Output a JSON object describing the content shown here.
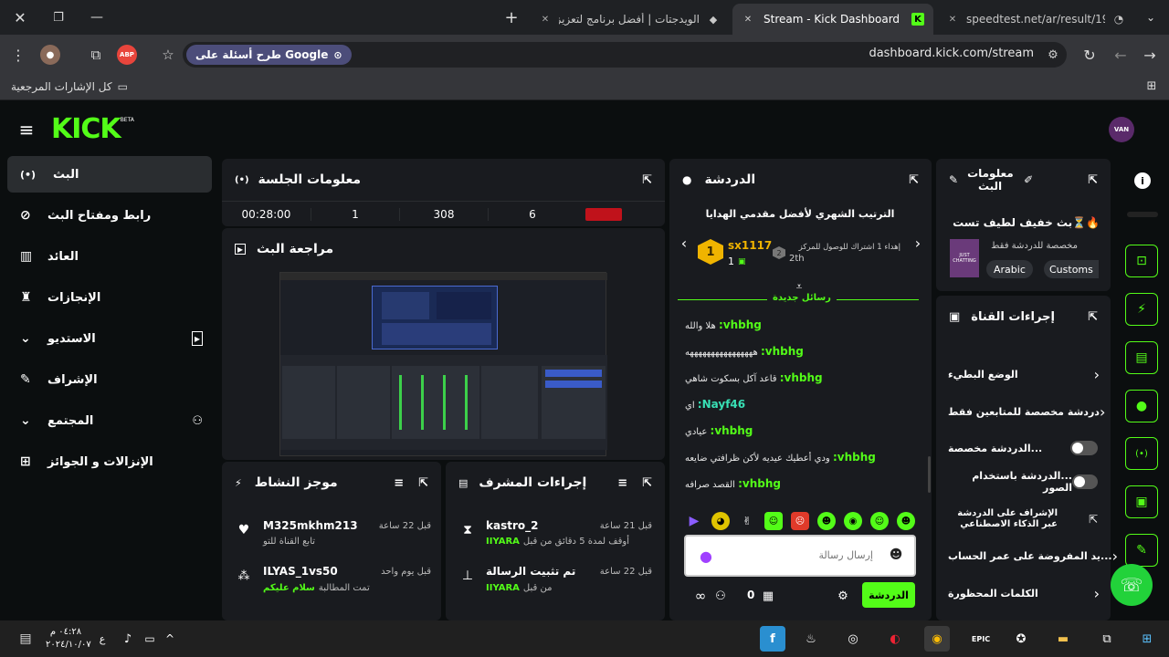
{
  "browser": {
    "tabs": [
      {
        "label": "speedtest.net/ar/result/190016"
      },
      {
        "label": "Stream - Kick Dashboard"
      },
      {
        "label": "الويدجتات | أفضل برنامج لتعزيز ال"
      }
    ],
    "url": "dashboard.kick.com/stream",
    "google_chip": "طرح أسئلة على Google",
    "abp_badge": "ABP",
    "bookmarks_label": "كل الإشارات المرجعية"
  },
  "kick": {
    "logo": "KICK",
    "logo_badge": "BETA",
    "avatar_text": "VAN"
  },
  "sidebar": {
    "items": [
      {
        "label": "البث"
      },
      {
        "label": "رابط ومفتاح البث"
      },
      {
        "label": "العائد"
      },
      {
        "label": "الإنجازات"
      },
      {
        "label": "الاستديو"
      },
      {
        "label": "الإشراف"
      },
      {
        "label": "المجتمع"
      },
      {
        "label": "الإنزالات و الجوائز"
      }
    ]
  },
  "session": {
    "title": "معلومات الجلسة",
    "stats": [
      "00:28:00",
      "1",
      "308",
      "6"
    ]
  },
  "preview": {
    "title": "مراجعة البث"
  },
  "activity": {
    "title": "موجز النشاط",
    "items": [
      {
        "user": "M325mkhm213",
        "time": "قبل 22 ساعة",
        "desc": "تابع القناة للتو"
      },
      {
        "user": "ILYAS_1vs50",
        "time": "قبل يوم واحد",
        "desc": "تمت المطالبة",
        "desc_highlight": "سلام عليكم"
      }
    ]
  },
  "modactions": {
    "title": "إجراءات المشرف",
    "items": [
      {
        "user": "kastro_2",
        "time": "قبل 21 ساعة",
        "desc": "أوقف لمدة 5 دقائق من قبل",
        "by": "IIYARA"
      },
      {
        "user": "تم تثبيت الرسالة",
        "time": "قبل 22 ساعة",
        "desc": "من قبل",
        "by": "IIYARA"
      }
    ]
  },
  "chat": {
    "title": "الدردشة",
    "leaderboard_title": "الترتيب الشهري لأفضل مقدمي الهدايا",
    "top_user": "sx1117",
    "top_count": "1",
    "top_rank": "1",
    "gift_goal": "إهداء 1 اشتراك للوصول للمركز",
    "gift_rank": "2th",
    "new_messages": "رسائل جديدة",
    "messages": [
      {
        "user": "vhbhg:",
        "text": "هلا والله"
      },
      {
        "user": "vhbhg:",
        "text": "ههههههههههههههههه"
      },
      {
        "user": "vhbhg:",
        "text": "قاعد آكل بسكوت شاهي"
      },
      {
        "user": "Nayf46:",
        "text": "اي",
        "alt": true
      },
      {
        "user": "vhbhg:",
        "text": "عيادي"
      },
      {
        "user": "vhbhg:",
        "text": "ودي أعطيك عيديه لأكن ظرافتي ضايعه"
      },
      {
        "user": "vhbhg:",
        "text": "القصد صرافه"
      }
    ],
    "input_placeholder": "إرسال رسالة",
    "send_label": "الدردشة",
    "counter": "0"
  },
  "stream_info": {
    "title": "معلومات البث",
    "stream_title": "🔥⏳بث خفيف لطيف تست | 300",
    "subtitle": "مخصصة للدردشة فقط",
    "tags": [
      "Arabic",
      "Customs"
    ],
    "thumb_text": "JUST CHATTING"
  },
  "channel_actions": {
    "title": "إجراءات القناة",
    "items": [
      {
        "label": "الوضع البطيء",
        "control": "chevron"
      },
      {
        "label": "دردشة مخصصة للمتابعين فقط",
        "control": "chevron"
      },
      {
        "label": "...الدردشة مخصصة",
        "control": "toggle"
      },
      {
        "label": "...الدردشة باستخدام الصور",
        "control": "toggle"
      },
      {
        "label": "الإشراف على الدردشة عبر الذكاء الاصطناعي",
        "control": "link"
      },
      {
        "label": "...يد المفروضة على عمر الحساب",
        "control": "chevron"
      },
      {
        "label": "الكلمات المحظورة",
        "control": "chevron"
      }
    ]
  },
  "taskbar": {
    "time": "٠٤:٢٨ م",
    "date": "٢٠٢٤/١٠/٠٧",
    "lang": "ع"
  },
  "colors": {
    "accent": "#53fc18",
    "bg": "#0b0e0f",
    "card": "#191b1f"
  }
}
